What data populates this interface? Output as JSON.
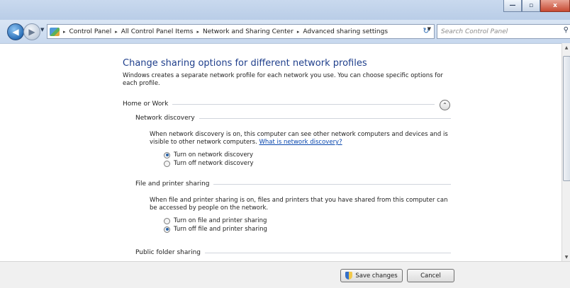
{
  "window": {
    "minimize_glyph": "—",
    "maximize_glyph": "▫",
    "close_glyph": "x"
  },
  "nav": {
    "back_glyph": "◀",
    "forward_glyph": "▶",
    "breadcrumbs": [
      "Control Panel",
      "All Control Panel Items",
      "Network and Sharing Center",
      "Advanced sharing settings"
    ],
    "separator": "▸",
    "refresh_glyph": "↻",
    "search_placeholder": "Search Control Panel"
  },
  "main": {
    "title": "Change sharing options for different network profiles",
    "intro": "Windows creates a separate network profile for each network you use. You can choose specific options for each profile.",
    "profile": {
      "name": "Home or Work",
      "collapse_glyph": "⌃"
    },
    "network_discovery": {
      "heading": "Network discovery",
      "description": "When network discovery is on, this computer can see other network computers and devices and is visible to other network computers.",
      "link": "What is network discovery?",
      "options": [
        {
          "label": "Turn on network discovery",
          "selected": true
        },
        {
          "label": "Turn off network discovery",
          "selected": false
        }
      ]
    },
    "file_sharing": {
      "heading": "File and printer sharing",
      "description": "When file and printer sharing is on, files and printers that you have shared from this computer can be accessed by people on the network.",
      "options": [
        {
          "label": "Turn on file and printer sharing",
          "selected": false
        },
        {
          "label": "Turn off file and printer sharing",
          "selected": true
        }
      ]
    },
    "public_folder": {
      "heading": "Public folder sharing"
    }
  },
  "footer": {
    "save_label": "Save changes",
    "cancel_label": "Cancel"
  },
  "icons": {
    "shield": "uac-shield-icon",
    "control_panel": "control-panel-icon",
    "search": "search-icon"
  }
}
